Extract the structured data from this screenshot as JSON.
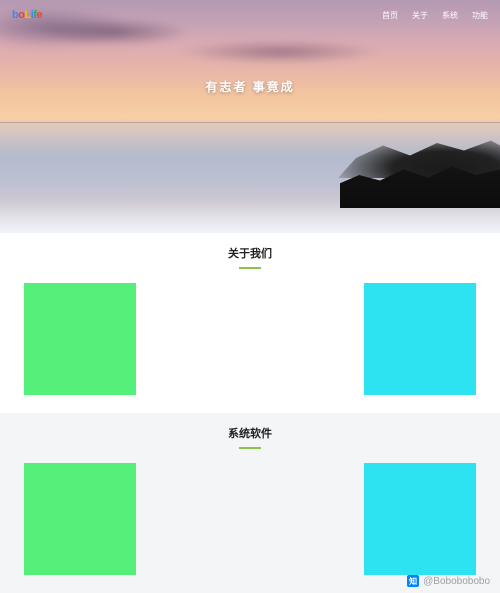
{
  "logo": {
    "chars": [
      "b",
      "o",
      "L",
      "i",
      "f",
      "e"
    ]
  },
  "nav": {
    "items": [
      "首页",
      "关于",
      "系统",
      "功能"
    ]
  },
  "hero": {
    "motto": "有志者  事竟成"
  },
  "sections": [
    {
      "title": "关于我们",
      "bg": "white",
      "cards": [
        {
          "color": "#55f07a",
          "name": "about-card-green"
        },
        {
          "color": "#2de3f2",
          "name": "about-card-cyan"
        }
      ]
    },
    {
      "title": "系统软件",
      "bg": "alt",
      "cards": [
        {
          "color": "#55f07a",
          "name": "system-card-green"
        },
        {
          "color": "#2de3f2",
          "name": "system-card-cyan"
        }
      ]
    }
  ],
  "watermark": {
    "icon_label": "知",
    "text": "@Bobobobobo"
  },
  "colors": {
    "accent_underline": "#8bc34a",
    "card_green": "#55f07a",
    "card_cyan": "#2de3f2"
  }
}
